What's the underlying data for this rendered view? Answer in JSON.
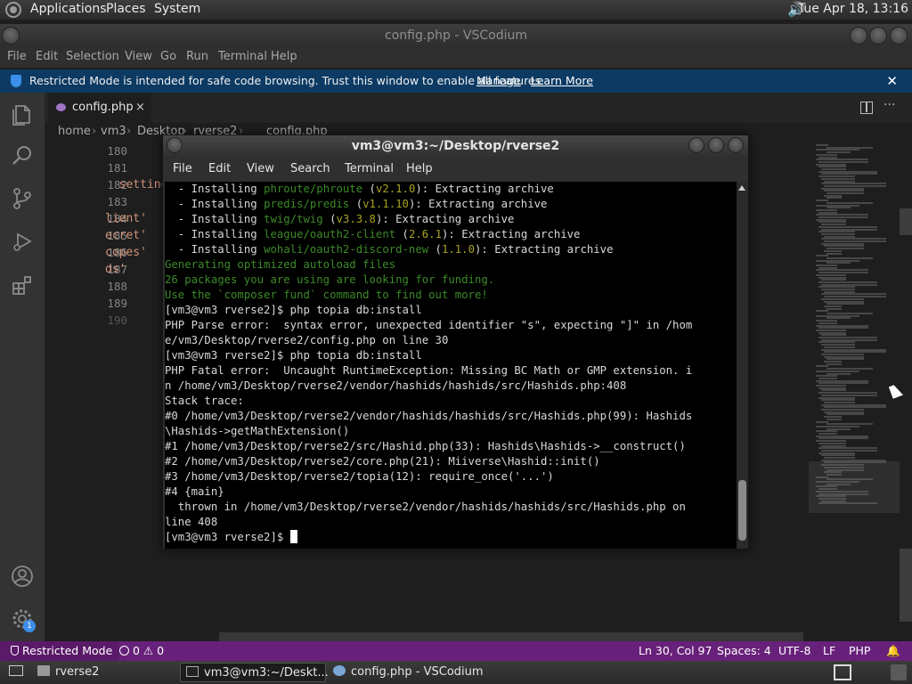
{
  "top_panel": {
    "menus": [
      "Applications",
      "Places",
      "System"
    ],
    "clock": "Tue Apr 18, 13:16"
  },
  "vscodium": {
    "title": "config.php - VSCodium",
    "menu": [
      "File",
      "Edit",
      "Selection",
      "View",
      "Go",
      "Run",
      "Terminal",
      "Help"
    ],
    "restricted_banner": {
      "message": "Restricted Mode is intended for safe code browsing. Trust this window to enable all features.",
      "manage": "Manage",
      "learn_more": "Learn More"
    },
    "tab": {
      "label": "config.php",
      "close": "×"
    },
    "breadcrumb": [
      "home",
      "vm3",
      "Desktop",
      "rverse2",
      "config.php"
    ],
    "line_numbers": [
      "180",
      "181",
      "182",
      "183",
      "184",
      "185",
      "186",
      "187",
      "188",
      "189",
      "190"
    ],
    "code_lines": [
      "",
      "",
      "  setting",
      "",
      "lient'",
      "ecret'",
      "copes'",
      "ds'",
      "",
      "",
      ""
    ],
    "status": {
      "mode": "Restricted Mode",
      "problems": "0 ⚠ 0",
      "position": "Ln 30, Col 97",
      "spaces": "Spaces: 4",
      "encoding": "UTF-8",
      "eol": "LF",
      "language": "PHP"
    },
    "accent_color": "#68217a",
    "banner_color": "#0c3a63",
    "settings_badge": "1"
  },
  "terminal": {
    "title": "vm3@vm3:~/Desktop/rverse2",
    "menu": [
      "File",
      "Edit",
      "View",
      "Search",
      "Terminal",
      "Help"
    ],
    "lines": [
      {
        "segments": [
          {
            "t": "  - Installing ",
            "c": "w"
          },
          {
            "t": "phroute/phroute",
            "c": "g"
          },
          {
            "t": " (",
            "c": "w"
          },
          {
            "t": "v2.1.0",
            "c": "y"
          },
          {
            "t": "): Extracting archive",
            "c": "w"
          }
        ]
      },
      {
        "segments": [
          {
            "t": "  - Installing ",
            "c": "w"
          },
          {
            "t": "predis/predis",
            "c": "g"
          },
          {
            "t": " (",
            "c": "w"
          },
          {
            "t": "v1.1.10",
            "c": "y"
          },
          {
            "t": "): Extracting archive",
            "c": "w"
          }
        ]
      },
      {
        "segments": [
          {
            "t": "  - Installing ",
            "c": "w"
          },
          {
            "t": "twig/twig",
            "c": "g"
          },
          {
            "t": " (",
            "c": "w"
          },
          {
            "t": "v3.3.8",
            "c": "y"
          },
          {
            "t": "): Extracting archive",
            "c": "w"
          }
        ]
      },
      {
        "segments": [
          {
            "t": "  - Installing ",
            "c": "w"
          },
          {
            "t": "league/oauth2-client",
            "c": "g"
          },
          {
            "t": " (",
            "c": "w"
          },
          {
            "t": "2.6.1",
            "c": "y"
          },
          {
            "t": "): Extracting archive",
            "c": "w"
          }
        ]
      },
      {
        "segments": [
          {
            "t": "  - Installing ",
            "c": "w"
          },
          {
            "t": "wohali/oauth2-discord-new",
            "c": "g"
          },
          {
            "t": " (",
            "c": "w"
          },
          {
            "t": "1.1.0",
            "c": "y"
          },
          {
            "t": "): Extracting archive",
            "c": "w"
          }
        ]
      },
      {
        "segments": [
          {
            "t": "Generating optimized autoload files",
            "c": "g"
          }
        ]
      },
      {
        "segments": [
          {
            "t": "26 packages you are using are looking for funding.",
            "c": "g"
          }
        ]
      },
      {
        "segments": [
          {
            "t": "Use the `composer fund` command to find out more!",
            "c": "g"
          }
        ]
      },
      {
        "segments": [
          {
            "t": "[vm3@vm3 rverse2]$ php topia db:install",
            "c": "w"
          }
        ]
      },
      {
        "segments": [
          {
            "t": "PHP Parse error:  syntax error, unexpected identifier \"s\", expecting \"]\" in /hom",
            "c": "w"
          }
        ]
      },
      {
        "segments": [
          {
            "t": "e/vm3/Desktop/rverse2/config.php on line 30",
            "c": "w"
          }
        ]
      },
      {
        "segments": [
          {
            "t": "[vm3@vm3 rverse2]$ php topia db:install",
            "c": "w"
          }
        ]
      },
      {
        "segments": [
          {
            "t": "PHP Fatal error:  Uncaught RuntimeException: Missing BC Math or GMP extension. i",
            "c": "w"
          }
        ]
      },
      {
        "segments": [
          {
            "t": "n /home/vm3/Desktop/rverse2/vendor/hashids/hashids/src/Hashids.php:408",
            "c": "w"
          }
        ]
      },
      {
        "segments": [
          {
            "t": "Stack trace:",
            "c": "w"
          }
        ]
      },
      {
        "segments": [
          {
            "t": "#0 /home/vm3/Desktop/rverse2/vendor/hashids/hashids/src/Hashids.php(99): Hashids",
            "c": "w"
          }
        ]
      },
      {
        "segments": [
          {
            "t": "\\Hashids->getMathExtension()",
            "c": "w"
          }
        ]
      },
      {
        "segments": [
          {
            "t": "#1 /home/vm3/Desktop/rverse2/src/Hashid.php(33): Hashids\\Hashids->__construct()",
            "c": "w"
          }
        ]
      },
      {
        "segments": [
          {
            "t": "#2 /home/vm3/Desktop/rverse2/core.php(21): Miiverse\\Hashid::init()",
            "c": "w"
          }
        ]
      },
      {
        "segments": [
          {
            "t": "#3 /home/vm3/Desktop/rverse2/topia(12): require_once('...')",
            "c": "w"
          }
        ]
      },
      {
        "segments": [
          {
            "t": "#4 {main}",
            "c": "w"
          }
        ]
      },
      {
        "segments": [
          {
            "t": "  thrown in /home/vm3/Desktop/rverse2/vendor/hashids/hashids/src/Hashids.php on",
            "c": "w"
          }
        ]
      },
      {
        "segments": [
          {
            "t": "line 408",
            "c": "w"
          }
        ]
      }
    ],
    "prompt": "[vm3@vm3 rverse2]$ "
  },
  "taskbar": {
    "items": [
      "rverse2",
      "vm3@vm3:~/Deskt...",
      "config.php - VSCodium"
    ],
    "active_index": 1
  }
}
